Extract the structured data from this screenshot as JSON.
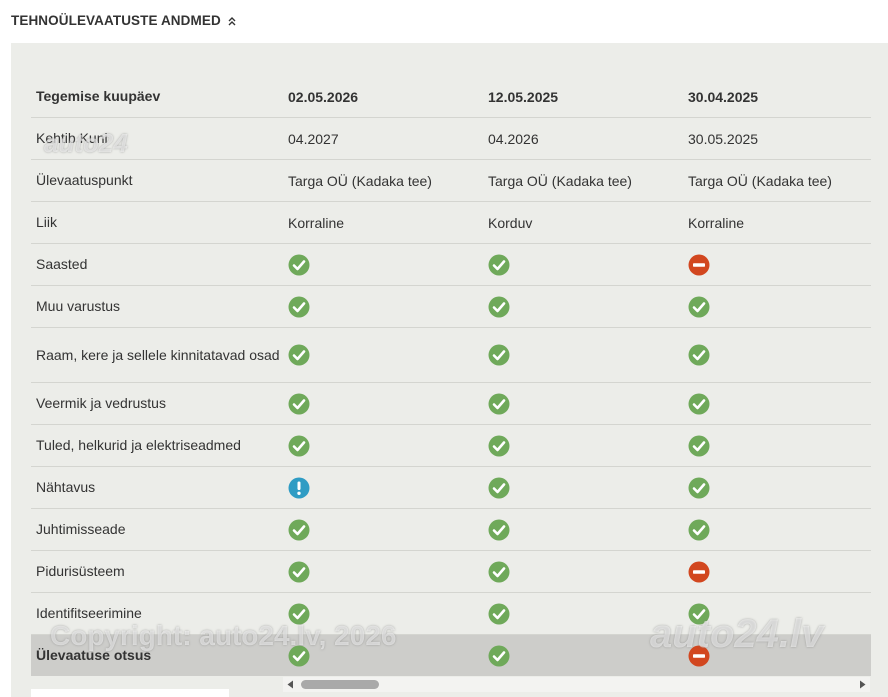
{
  "section": {
    "title": "TEHNOÜLEVAATUSTE ANDMED",
    "toggle_icon": "chevron-double-up-icon"
  },
  "table": {
    "header": {
      "label": "Tegemise kuupäev",
      "values": [
        "02.05.2026",
        "12.05.2025",
        "30.04.2025"
      ]
    },
    "text_rows": [
      {
        "label": "Kehtib Kuni",
        "values": [
          "04.2027",
          "04.2026",
          "30.05.2025"
        ]
      },
      {
        "label": "Ülevaatuspunkt",
        "values": [
          "Targa OÜ (Kadaka tee)",
          "Targa OÜ (Kadaka tee)",
          "Targa OÜ (Kadaka tee)"
        ]
      },
      {
        "label": "Liik",
        "values": [
          "Korraline",
          "Korduv",
          "Korraline"
        ]
      }
    ],
    "status_rows": [
      {
        "label": "Saasted",
        "status": [
          "ok",
          "ok",
          "fail"
        ]
      },
      {
        "label": "Muu varustus",
        "status": [
          "ok",
          "ok",
          "ok"
        ]
      },
      {
        "label": "Raam, kere ja sellele kinnitatavad osad",
        "status": [
          "ok",
          "ok",
          "ok"
        ]
      },
      {
        "label": "Veermik ja vedrustus",
        "status": [
          "ok",
          "ok",
          "ok"
        ]
      },
      {
        "label": "Tuled, helkurid ja elektriseadmed",
        "status": [
          "ok",
          "ok",
          "ok"
        ]
      },
      {
        "label": "Nähtavus",
        "status": [
          "warning",
          "ok",
          "ok"
        ]
      },
      {
        "label": "Juhtimisseade",
        "status": [
          "ok",
          "ok",
          "ok"
        ]
      },
      {
        "label": "Pidurisüsteem",
        "status": [
          "ok",
          "ok",
          "fail"
        ]
      },
      {
        "label": "Identifitseerimine",
        "status": [
          "ok",
          "ok",
          "ok"
        ]
      }
    ],
    "final_row": {
      "label": "Ülevaatuse otsus",
      "status": [
        "ok",
        "ok",
        "fail"
      ]
    }
  },
  "status_colors": {
    "ok": "#6fa95a",
    "fail": "#d2471f",
    "warning": "#2f9cc4"
  },
  "status_icons": {
    "ok": "check-circle-icon",
    "fail": "minus-circle-icon",
    "warning": "exclamation-circle-icon"
  },
  "watermarks": {
    "logo_small": "auto24",
    "copyright": "Copyright: auto24.lv, 2026",
    "logo_large": "auto24.lv"
  }
}
